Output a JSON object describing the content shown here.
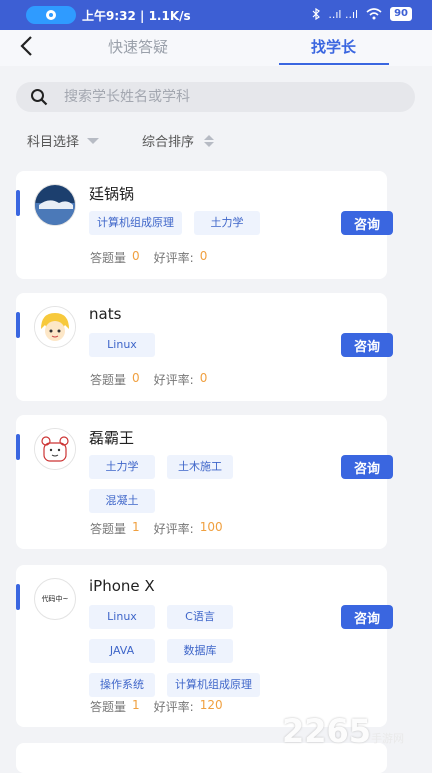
{
  "status_bar": {
    "time": "上午9:32 | 1.1K/s",
    "battery": "90",
    "signal_text": "..ıl ..ıl"
  },
  "header": {
    "tabs": [
      {
        "label": "快速答疑",
        "active": false
      },
      {
        "label": "找学长",
        "active": true
      }
    ]
  },
  "search": {
    "placeholder": "搜索学长姓名或学科"
  },
  "filters": {
    "subject_label": "科目选择",
    "sort_label": "综合排序"
  },
  "cards": [
    {
      "name": "廷锅锅",
      "tags": [
        "计算机组成原理",
        "土力学"
      ],
      "consult_label": "咨询",
      "answers_label": "答题量",
      "answers": "0",
      "rating_label": "好评率:",
      "rating": "0"
    },
    {
      "name": "nats",
      "tags": [
        "Linux"
      ],
      "consult_label": "咨询",
      "answers_label": "答题量",
      "answers": "0",
      "rating_label": "好评率:",
      "rating": "0"
    },
    {
      "name": "磊霸王",
      "tags": [
        "土力学",
        "土木施工",
        "混凝土"
      ],
      "consult_label": "咨询",
      "answers_label": "答题量",
      "answers": "1",
      "rating_label": "好评率:",
      "rating": "100"
    },
    {
      "name": "iPhone X",
      "avatar_text": "代码中~",
      "tags": [
        "Linux",
        "C语言",
        "JAVA",
        "数据库",
        "操作系统",
        "计算机组成原理"
      ],
      "consult_label": "咨询",
      "answers_label": "答题量",
      "answers": "1",
      "rating_label": "好评率:",
      "rating": "120"
    }
  ],
  "watermark": {
    "text": "2265",
    "sub": "手游网"
  },
  "colors": {
    "accent": "#3a66e0",
    "status_bar": "#3d5fd4",
    "tag_bg": "#eef3fd",
    "stat_number": "#f0a040"
  }
}
